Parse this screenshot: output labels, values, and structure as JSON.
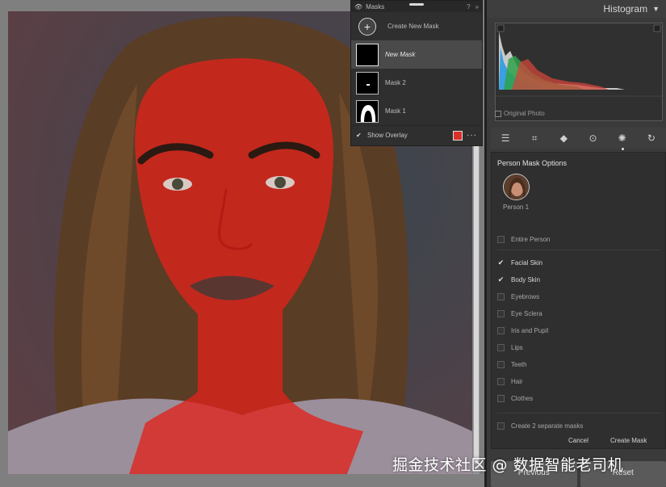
{
  "masks_panel": {
    "title": "Masks",
    "help": "?",
    "expand": "»",
    "create_new": "Create New Mask",
    "items": [
      {
        "label": "New Mask"
      },
      {
        "label": "Mask 2"
      },
      {
        "label": "Mask 1"
      }
    ],
    "show_overlay": "Show Overlay",
    "overlay_color": "#d8312a"
  },
  "histogram": {
    "title": "Histogram",
    "original_photo": "Original Photo"
  },
  "toolbar": {
    "tools": [
      "sliders-icon",
      "crop-icon",
      "eraser-icon",
      "redeye-icon",
      "masking-icon",
      "reset-icon"
    ],
    "active_tool": "masking-icon"
  },
  "person_mask": {
    "title": "Person Mask Options",
    "person_label": "Person 1",
    "entire_person": "Entire Person",
    "options": [
      {
        "label": "Facial Skin",
        "checked": true
      },
      {
        "label": "Body Skin",
        "checked": true
      },
      {
        "label": "Eyebrows",
        "checked": false
      },
      {
        "label": "Eye Sclera",
        "checked": false
      },
      {
        "label": "Iris and Pupil",
        "checked": false
      },
      {
        "label": "Lips",
        "checked": false
      },
      {
        "label": "Teeth",
        "checked": false
      },
      {
        "label": "Hair",
        "checked": false
      },
      {
        "label": "Clothes",
        "checked": false
      }
    ],
    "separate_masks": "Create 2 separate masks",
    "cancel": "Cancel",
    "create": "Create Mask"
  },
  "bottom": {
    "previous": "Previous",
    "reset": "Reset"
  },
  "watermark": "掘金技术社区 @ 数据智能老司机"
}
